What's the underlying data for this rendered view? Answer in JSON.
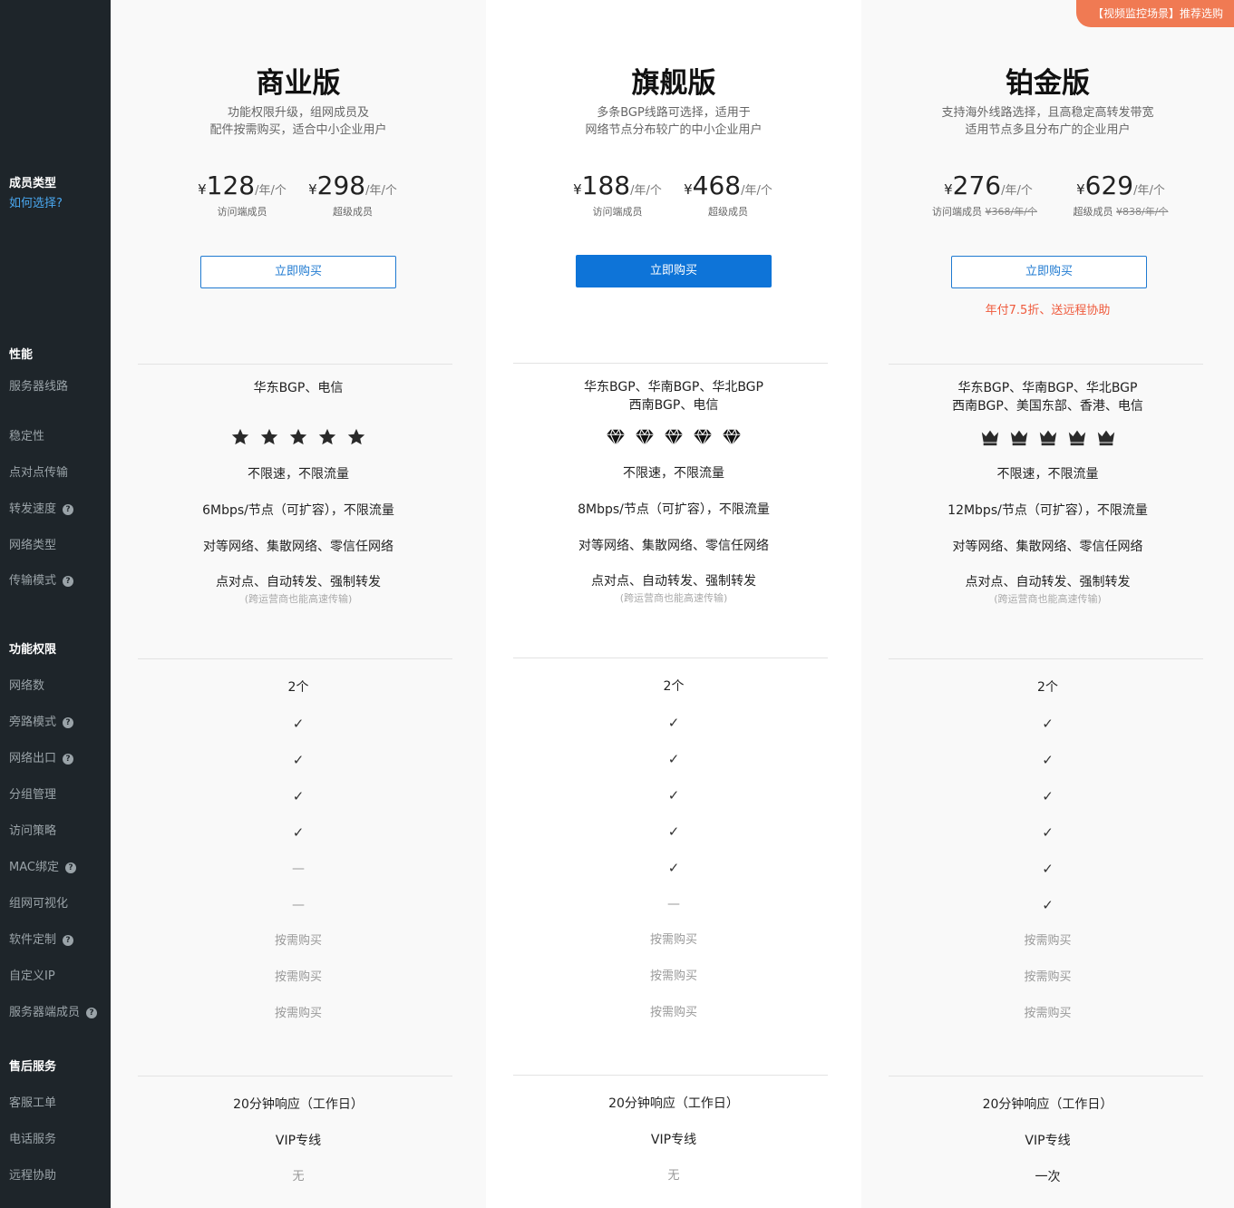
{
  "sidebar": {
    "member_type": "成员类型",
    "how_choose": "如何选择?",
    "sections": {
      "performance": "性能",
      "features": "功能权限",
      "aftersales": "售后服务"
    },
    "items": {
      "server_line": "服务器线路",
      "stability": "稳定性",
      "p2p": "点对点传输",
      "speed": "转发速度",
      "network_type": "网络类型",
      "transfer_mode": "传输模式",
      "network_count": "网络数",
      "bypass": "旁路模式",
      "exit": "网络出口",
      "group": "分组管理",
      "policy": "访问策略",
      "mac": "MAC绑定",
      "visual": "组网可视化",
      "custom_sw": "软件定制",
      "custom_ip": "自定义IP",
      "server_member": "服务器端成员",
      "ticket": "客服工单",
      "phone": "电话服务",
      "remote": "远程协助"
    },
    "help_glyph": "?"
  },
  "common": {
    "currency": "¥",
    "unit": "/年/个",
    "visitor_label": "访问端成员",
    "super_label": "超级成员",
    "buy": "立即购买",
    "check": "✓",
    "dash": "—",
    "on_demand": "按需购买",
    "transfer_sub": "(跨运营商也能高速传输)"
  },
  "plans": [
    {
      "title": "商业版",
      "desc1": "功能权限升级，组网成员及",
      "desc2": "配件按需购买，适合中小企业用户",
      "visitor_price": "128",
      "super_price": "298",
      "lines1": "华东BGP、电信",
      "lines2": "",
      "rating_icon": "star-icon",
      "rating_count": 5,
      "p2p": "不限速，不限流量",
      "speed": "6Mbps/节点（可扩容），不限流量",
      "network_type": "对等网络、集散网络、零信任网络",
      "transfer_mode": "点对点、自动转发、强制转发",
      "network_count": "2个",
      "aftersales": {
        "ticket": "20分钟响应（工作日）",
        "phone": "VIP专线",
        "remote": "无"
      }
    },
    {
      "title": "旗舰版",
      "desc1": "多条BGP线路可选择，适用于",
      "desc2": "网络节点分布较广的中小企业用户",
      "visitor_price": "188",
      "super_price": "468",
      "lines1": "华东BGP、华南BGP、华北BGP",
      "lines2": "西南BGP、电信",
      "rating_icon": "diamond-icon",
      "rating_count": 5,
      "p2p": "不限速，不限流量",
      "speed": "8Mbps/节点（可扩容），不限流量",
      "network_type": "对等网络、集散网络、零信任网络",
      "transfer_mode": "点对点、自动转发、强制转发",
      "network_count": "2个",
      "aftersales": {
        "ticket": "20分钟响应（工作日）",
        "phone": "VIP专线",
        "remote": "无"
      }
    },
    {
      "title": "铂金版",
      "badge": "【视频监控场景】推荐选购",
      "desc1": "支持海外线路选择，且高稳定高转发带宽",
      "desc2": "适用节点多且分布广的企业用户",
      "visitor_price": "276",
      "super_price": "629",
      "visitor_old": "¥368/年/个",
      "super_old": "¥838/年/个",
      "promo": "年付7.5折、送远程协助",
      "lines1": "华东BGP、华南BGP、华北BGP",
      "lines2": "西南BGP、美国东部、香港、电信",
      "rating_icon": "crown-icon",
      "rating_count": 5,
      "p2p": "不限速，不限流量",
      "speed": "12Mbps/节点（可扩容），不限流量",
      "network_type": "对等网络、集散网络、零信任网络",
      "transfer_mode": "点对点、自动转发、强制转发",
      "network_count": "2个",
      "aftersales": {
        "ticket": "20分钟响应（工作日）",
        "phone": "VIP专线",
        "remote": "一次"
      }
    }
  ]
}
